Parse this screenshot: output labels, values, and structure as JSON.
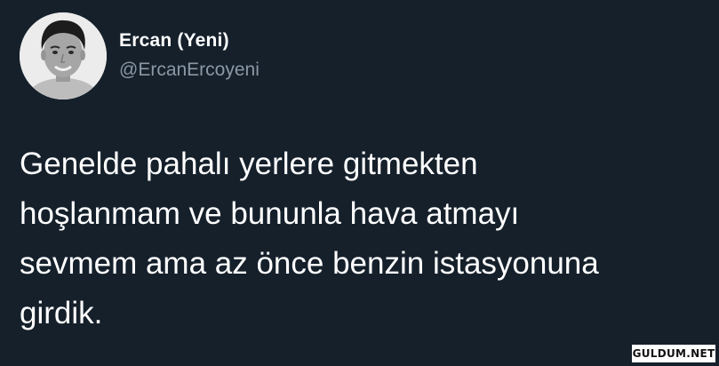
{
  "author": {
    "display_name": "Ercan (Yeni)",
    "handle": "@ErcanErcoyeni"
  },
  "tweet": {
    "lines": [
      "Genelde pahalı yerlere gitmekten",
      "hoşlanmam ve bununla hava atmayı",
      "sevmem ama az önce benzin istasyonuna",
      "girdik."
    ]
  },
  "watermark": {
    "text": "GULDUM.NET"
  },
  "colors": {
    "background": "#15202b",
    "primary_text": "#ffffff",
    "secondary_text": "#8b98a5"
  }
}
